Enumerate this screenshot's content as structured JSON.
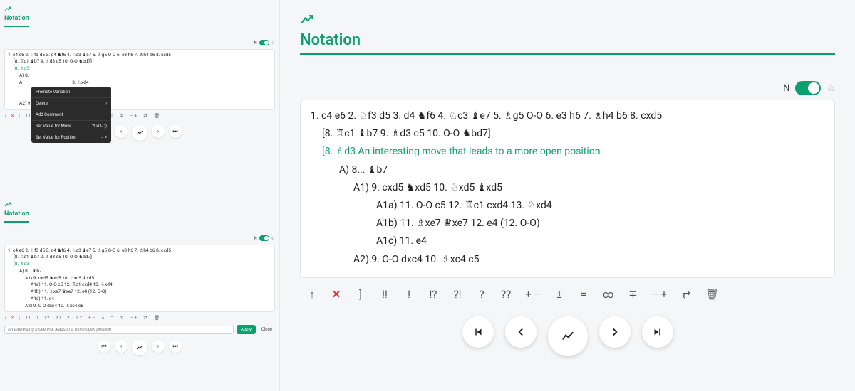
{
  "left_top": {
    "title": "Notation",
    "toggle_label": "N",
    "mainline": "1. c4 e6 2. ♘f3 d5 3. d4 ♞f6 4. ♘c3 ♝e7 5. ♗g5 O-O 6. e3 h6 7. ♗h4 b6 8. cxd5",
    "var_a": "[8. ♖c1 ♝b7 9. ♗d3 c5 10. O-O ♞bd7]",
    "var_b_head": "[8. ♗d3",
    "A": "A) 8.",
    "A_tail": "3. ♘xd4",
    "A2": "A2) 9. O-O dxc4 10. ♗xc4 c5",
    "ctx": {
      "promote": "Promote Variation",
      "delete": "Delete",
      "add_comment": "Add Comment",
      "set_move": "Set Value for Move",
      "set_move_hint": "?! >O-O)",
      "set_pos": "Set Value for Position",
      "set_pos_hint": "= >"
    },
    "tools": "↑   ✕   ]   !!   !   !?   ?!   ?   ??   +−   ±   =   ∓   −+   ⇄   🗑",
    "nav": [
      "⏮",
      "‹",
      "〰",
      "›",
      "⏭"
    ]
  },
  "left_bottom": {
    "title": "Notation",
    "toggle_label": "N",
    "mainline": "1. c4 e6 2. ♘f3 d5 3. d4 ♞f6 4. ♘c3 ♝e7 5. ♗g5 O-O 6. e3 h6 7. ♗h4 b6 8. cxd5",
    "var_a": "[8. ♖c1 ♝b7 9. ♗d3 c5 10. O-O ♞bd7]",
    "var_b_head": "[8. ♗d3",
    "A": "A) 8... ♝b7",
    "A1": "A1) 9. cxd5 ♞xd5 10. ♘xd5 ♝xd5",
    "A1a": "A1a) 11. O-O c5 12. ♖c1 cxd4 13. ♘xd4",
    "A1b": "A1b) 11. ♗xe7 ♛xe7 12. e4 (12. O-O)",
    "A1c": "A1c) 11. e4",
    "A2": "A2) 9. O-O dxc4 10. ♗xc4 c5",
    "comment_placeholder": "An interesting move that leads to a more open position",
    "apply": "Apply",
    "close": "Close",
    "tools": "↑   ✕   ]   !!   !   !?   ?!   ?   ??   +−   ±   =   ∓   −+   ⇄   🗑",
    "nav": [
      "⏮",
      "‹",
      "〰",
      "›",
      "⏭"
    ]
  },
  "main": {
    "title": "Notation",
    "toggle_label": "N",
    "mainline": "1. c4  e6  2. ♘f3  d5  3. d4  ♞f6  4. ♘c3  ♝e7  5. ♗g5  O-O  6. e3  h6  7. ♗h4  b6  8. cxd5",
    "var_a": "[8. ♖c1  ♝b7  9. ♗d3  c5  10. O-O  ♞bd7]",
    "var_b": "[8. ♗d3 An interesting move that leads to a more open position",
    "A": "A) 8... ♝b7",
    "A1": "A1) 9. cxd5  ♞xd5  10. ♘xd5  ♝xd5",
    "A1a": "A1a) 11. O-O  c5  12. ♖c1  cxd4  13. ♘xd4",
    "A1b": "A1b) 11. ♗xe7  ♛xe7  12. e4 (12. O-O)",
    "A1c": "A1c) 11. e4",
    "A2": "A2) 9. O-O  dxc4  10. ♗xc4  c5",
    "symbols": [
      "↑",
      "✕",
      "]",
      "!!",
      "!",
      "!?",
      "?!",
      "?",
      "??",
      "+ −",
      "±",
      "=",
      "∞",
      "∓",
      "− +",
      "⇄",
      "🗑"
    ],
    "nav": [
      "first",
      "prev",
      "analysis",
      "next",
      "last"
    ]
  }
}
